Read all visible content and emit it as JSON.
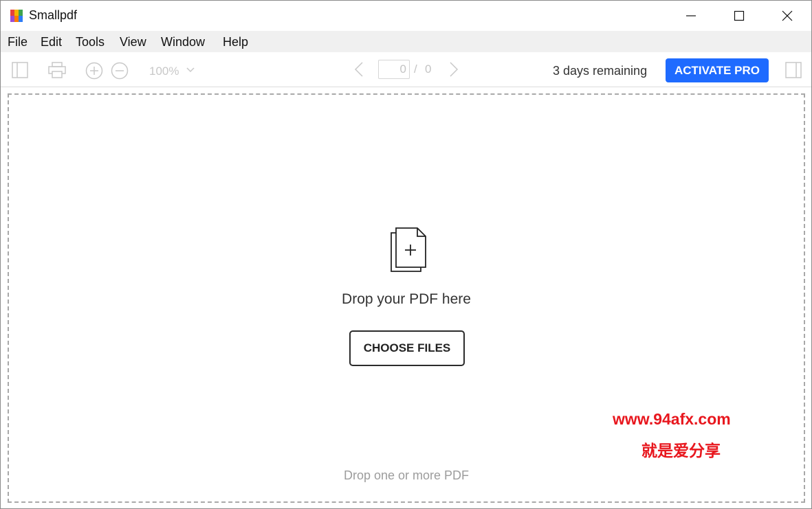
{
  "window": {
    "title": "Smallpdf",
    "logo_colors": [
      "#e8413c",
      "#f5b400",
      "#3fa34d",
      "#2e7cf6",
      "#9b4dd6",
      "#ff7a00"
    ]
  },
  "menu": {
    "items": [
      {
        "label": "File"
      },
      {
        "label": "Edit"
      },
      {
        "label": "Tools"
      },
      {
        "label": "View"
      },
      {
        "label": "Window"
      },
      {
        "label": "Help"
      }
    ]
  },
  "toolbar": {
    "zoom_level": "100%",
    "page_current": "0",
    "page_separator": "/",
    "page_total": "0",
    "trial_text": "3 days remaining",
    "activate_label": "ACTIVATE PRO"
  },
  "dropzone": {
    "title": "Drop your PDF here",
    "choose_label": "CHOOSE FILES",
    "hint": "Drop one or more PDF"
  },
  "watermark": {
    "url": "www.94afx.com",
    "tagline": "就是爱分享",
    "color": "#e8171e"
  },
  "colors": {
    "accent": "#1f6bff",
    "disabled_icon": "#c8c8c8"
  }
}
